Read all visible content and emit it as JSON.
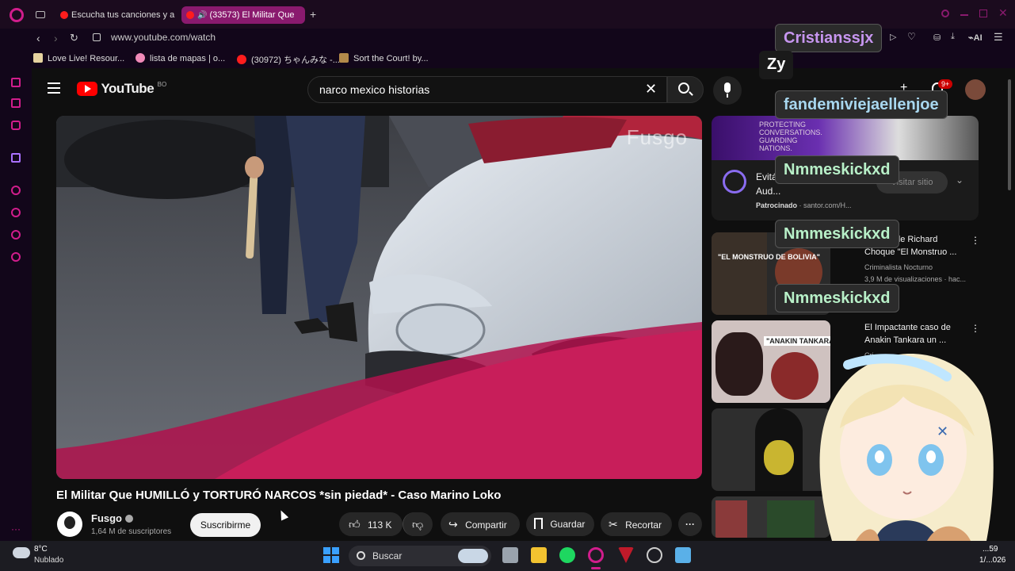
{
  "browser": {
    "tabs": [
      {
        "label": "Escucha tus canciones y a"
      },
      {
        "label": "(33573) El Militar Que"
      }
    ],
    "address": "www.youtube.com/watch",
    "bookmarks": [
      {
        "label": "Love Live! Resour..."
      },
      {
        "label": "lista de mapas | o..."
      },
      {
        "label": "(30972) ちゃんみな -..."
      },
      {
        "label": "Sort the Court! by..."
      }
    ]
  },
  "youtube": {
    "logo_text": "YouTube",
    "logo_region": "BO",
    "search_value": "narco mexico historias",
    "notif_count": "9+",
    "video": {
      "watermark": "Fusgo",
      "title": "El Militar Que HUMILLÓ y TORTURÓ NARCOS *sin piedad* - Caso Marino Loko",
      "channel": "Fusgo",
      "subscribers": "1,64 M de suscriptores",
      "subscribe_label": "Suscribirme",
      "likes": "113 K",
      "share_label": "Compartir",
      "save_label": "Guardar",
      "clip_label": "Recortar"
    },
    "ad": {
      "banner_lines": [
        "PROTECTING",
        "CONVERSATIONS.",
        "GUARDING",
        "NATIONS."
      ],
      "title": "Evitá...",
      "subtitle": "Aud...",
      "visit_label": "Visitar sitio",
      "sponsored": "Patrocinado",
      "domain": "santor.com/H..."
    },
    "recommendations": [
      {
        "thumb_text": "\"EL MONSTRUO DE BOLIVIA\"",
        "title": "El caso de Richard Choque \"El Monstruo ...",
        "channel": "Criminalista Nocturno",
        "meta": "3,9 M de visualizaciones · hac..."
      },
      {
        "thumb_text": "\"ANAKIN TANKARA\"",
        "title": "El Impactante caso de Anakin Tankara un ...",
        "channel": "Cri...",
        "meta": "...hac..."
      },
      {
        "thumb_text": "",
        "title": "",
        "channel": "",
        "meta": ""
      },
      {
        "thumb_text": "",
        "title": "",
        "channel": "",
        "meta": ""
      }
    ]
  },
  "chat_overlay": [
    {
      "name": "Cristianssjx"
    },
    {
      "name": "Zy"
    },
    {
      "name": "fandemiviejaellenjoe"
    },
    {
      "name": "Nmmeskickxd"
    },
    {
      "name": "Nmmeskickxd"
    },
    {
      "name": "Nmmeskickxd"
    }
  ],
  "taskbar": {
    "weather_temp": "8°C",
    "weather_desc": "Nublado",
    "search_label": "Buscar",
    "time": "...59",
    "date": "1/...026"
  },
  "colors": {
    "accent": "#d11d8c",
    "youtube_red": "#ff0000"
  }
}
